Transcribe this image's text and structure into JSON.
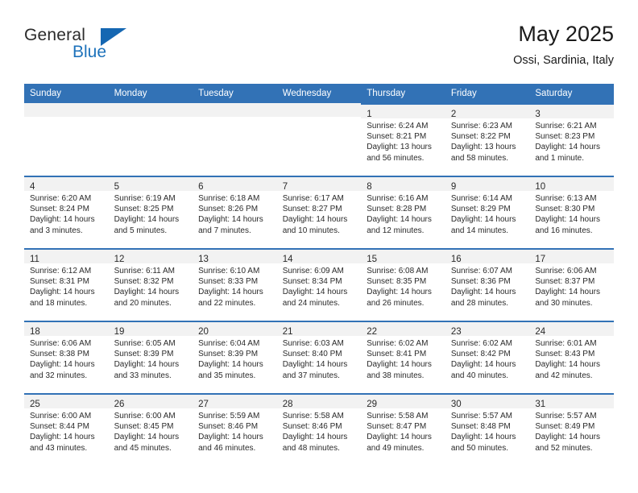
{
  "brand": {
    "name_primary": "General",
    "name_secondary": "Blue",
    "flag_color": "#1567b2"
  },
  "header": {
    "title": "May 2025",
    "location": "Ossi, Sardinia, Italy"
  },
  "theme": {
    "header_blue": "#3272b6",
    "band_gray": "#f2f2f2",
    "text": "#2a2a2a"
  },
  "weekdays": [
    "Sunday",
    "Monday",
    "Tuesday",
    "Wednesday",
    "Thursday",
    "Friday",
    "Saturday"
  ],
  "weeks": [
    [
      {
        "empty": true
      },
      {
        "empty": true
      },
      {
        "empty": true
      },
      {
        "empty": true
      },
      {
        "day": "1",
        "sunrise": "Sunrise: 6:24 AM",
        "sunset": "Sunset: 8:21 PM",
        "daylight1": "Daylight: 13 hours",
        "daylight2": "and 56 minutes."
      },
      {
        "day": "2",
        "sunrise": "Sunrise: 6:23 AM",
        "sunset": "Sunset: 8:22 PM",
        "daylight1": "Daylight: 13 hours",
        "daylight2": "and 58 minutes."
      },
      {
        "day": "3",
        "sunrise": "Sunrise: 6:21 AM",
        "sunset": "Sunset: 8:23 PM",
        "daylight1": "Daylight: 14 hours",
        "daylight2": "and 1 minute."
      }
    ],
    [
      {
        "day": "4",
        "sunrise": "Sunrise: 6:20 AM",
        "sunset": "Sunset: 8:24 PM",
        "daylight1": "Daylight: 14 hours",
        "daylight2": "and 3 minutes."
      },
      {
        "day": "5",
        "sunrise": "Sunrise: 6:19 AM",
        "sunset": "Sunset: 8:25 PM",
        "daylight1": "Daylight: 14 hours",
        "daylight2": "and 5 minutes."
      },
      {
        "day": "6",
        "sunrise": "Sunrise: 6:18 AM",
        "sunset": "Sunset: 8:26 PM",
        "daylight1": "Daylight: 14 hours",
        "daylight2": "and 7 minutes."
      },
      {
        "day": "7",
        "sunrise": "Sunrise: 6:17 AM",
        "sunset": "Sunset: 8:27 PM",
        "daylight1": "Daylight: 14 hours",
        "daylight2": "and 10 minutes."
      },
      {
        "day": "8",
        "sunrise": "Sunrise: 6:16 AM",
        "sunset": "Sunset: 8:28 PM",
        "daylight1": "Daylight: 14 hours",
        "daylight2": "and 12 minutes."
      },
      {
        "day": "9",
        "sunrise": "Sunrise: 6:14 AM",
        "sunset": "Sunset: 8:29 PM",
        "daylight1": "Daylight: 14 hours",
        "daylight2": "and 14 minutes."
      },
      {
        "day": "10",
        "sunrise": "Sunrise: 6:13 AM",
        "sunset": "Sunset: 8:30 PM",
        "daylight1": "Daylight: 14 hours",
        "daylight2": "and 16 minutes."
      }
    ],
    [
      {
        "day": "11",
        "sunrise": "Sunrise: 6:12 AM",
        "sunset": "Sunset: 8:31 PM",
        "daylight1": "Daylight: 14 hours",
        "daylight2": "and 18 minutes."
      },
      {
        "day": "12",
        "sunrise": "Sunrise: 6:11 AM",
        "sunset": "Sunset: 8:32 PM",
        "daylight1": "Daylight: 14 hours",
        "daylight2": "and 20 minutes."
      },
      {
        "day": "13",
        "sunrise": "Sunrise: 6:10 AM",
        "sunset": "Sunset: 8:33 PM",
        "daylight1": "Daylight: 14 hours",
        "daylight2": "and 22 minutes."
      },
      {
        "day": "14",
        "sunrise": "Sunrise: 6:09 AM",
        "sunset": "Sunset: 8:34 PM",
        "daylight1": "Daylight: 14 hours",
        "daylight2": "and 24 minutes."
      },
      {
        "day": "15",
        "sunrise": "Sunrise: 6:08 AM",
        "sunset": "Sunset: 8:35 PM",
        "daylight1": "Daylight: 14 hours",
        "daylight2": "and 26 minutes."
      },
      {
        "day": "16",
        "sunrise": "Sunrise: 6:07 AM",
        "sunset": "Sunset: 8:36 PM",
        "daylight1": "Daylight: 14 hours",
        "daylight2": "and 28 minutes."
      },
      {
        "day": "17",
        "sunrise": "Sunrise: 6:06 AM",
        "sunset": "Sunset: 8:37 PM",
        "daylight1": "Daylight: 14 hours",
        "daylight2": "and 30 minutes."
      }
    ],
    [
      {
        "day": "18",
        "sunrise": "Sunrise: 6:06 AM",
        "sunset": "Sunset: 8:38 PM",
        "daylight1": "Daylight: 14 hours",
        "daylight2": "and 32 minutes."
      },
      {
        "day": "19",
        "sunrise": "Sunrise: 6:05 AM",
        "sunset": "Sunset: 8:39 PM",
        "daylight1": "Daylight: 14 hours",
        "daylight2": "and 33 minutes."
      },
      {
        "day": "20",
        "sunrise": "Sunrise: 6:04 AM",
        "sunset": "Sunset: 8:39 PM",
        "daylight1": "Daylight: 14 hours",
        "daylight2": "and 35 minutes."
      },
      {
        "day": "21",
        "sunrise": "Sunrise: 6:03 AM",
        "sunset": "Sunset: 8:40 PM",
        "daylight1": "Daylight: 14 hours",
        "daylight2": "and 37 minutes."
      },
      {
        "day": "22",
        "sunrise": "Sunrise: 6:02 AM",
        "sunset": "Sunset: 8:41 PM",
        "daylight1": "Daylight: 14 hours",
        "daylight2": "and 38 minutes."
      },
      {
        "day": "23",
        "sunrise": "Sunrise: 6:02 AM",
        "sunset": "Sunset: 8:42 PM",
        "daylight1": "Daylight: 14 hours",
        "daylight2": "and 40 minutes."
      },
      {
        "day": "24",
        "sunrise": "Sunrise: 6:01 AM",
        "sunset": "Sunset: 8:43 PM",
        "daylight1": "Daylight: 14 hours",
        "daylight2": "and 42 minutes."
      }
    ],
    [
      {
        "day": "25",
        "sunrise": "Sunrise: 6:00 AM",
        "sunset": "Sunset: 8:44 PM",
        "daylight1": "Daylight: 14 hours",
        "daylight2": "and 43 minutes."
      },
      {
        "day": "26",
        "sunrise": "Sunrise: 6:00 AM",
        "sunset": "Sunset: 8:45 PM",
        "daylight1": "Daylight: 14 hours",
        "daylight2": "and 45 minutes."
      },
      {
        "day": "27",
        "sunrise": "Sunrise: 5:59 AM",
        "sunset": "Sunset: 8:46 PM",
        "daylight1": "Daylight: 14 hours",
        "daylight2": "and 46 minutes."
      },
      {
        "day": "28",
        "sunrise": "Sunrise: 5:58 AM",
        "sunset": "Sunset: 8:46 PM",
        "daylight1": "Daylight: 14 hours",
        "daylight2": "and 48 minutes."
      },
      {
        "day": "29",
        "sunrise": "Sunrise: 5:58 AM",
        "sunset": "Sunset: 8:47 PM",
        "daylight1": "Daylight: 14 hours",
        "daylight2": "and 49 minutes."
      },
      {
        "day": "30",
        "sunrise": "Sunrise: 5:57 AM",
        "sunset": "Sunset: 8:48 PM",
        "daylight1": "Daylight: 14 hours",
        "daylight2": "and 50 minutes."
      },
      {
        "day": "31",
        "sunrise": "Sunrise: 5:57 AM",
        "sunset": "Sunset: 8:49 PM",
        "daylight1": "Daylight: 14 hours",
        "daylight2": "and 52 minutes."
      }
    ]
  ]
}
